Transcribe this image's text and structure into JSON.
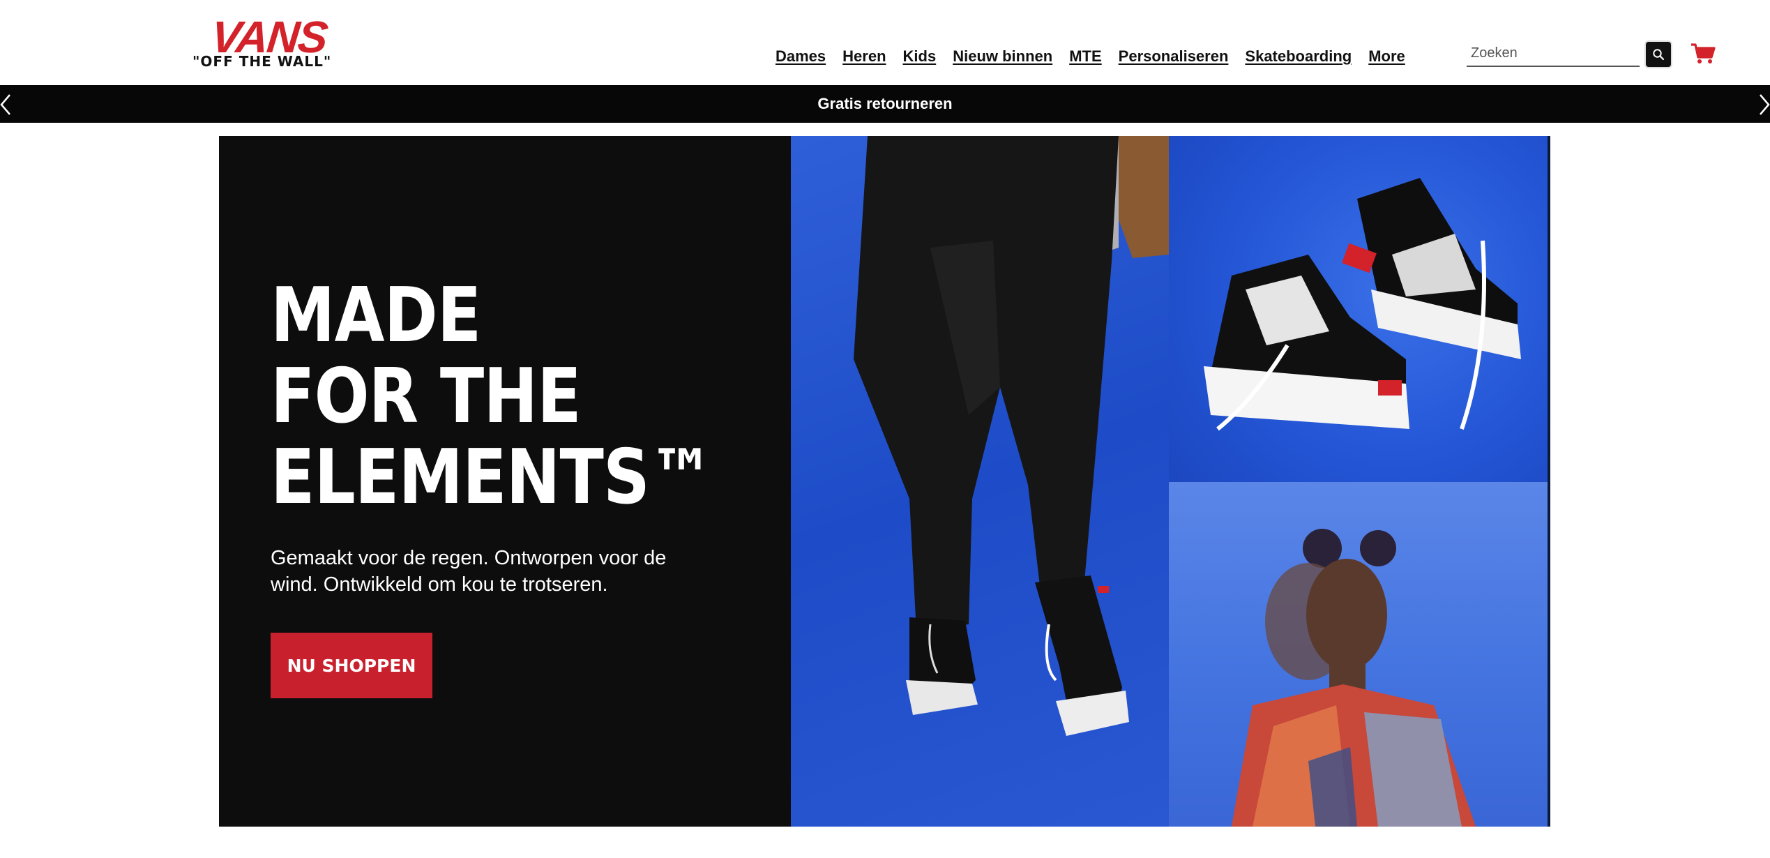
{
  "brand": {
    "logo_text": "VANS",
    "tagline": "\"OFF THE WALL\"",
    "accent": "#d3222a"
  },
  "nav": {
    "items": [
      {
        "label": "Dames"
      },
      {
        "label": "Heren"
      },
      {
        "label": "Kids"
      },
      {
        "label": "Nieuw binnen"
      },
      {
        "label": "MTE"
      },
      {
        "label": "Personaliseren"
      },
      {
        "label": "Skateboarding"
      },
      {
        "label": "More"
      }
    ]
  },
  "search": {
    "placeholder": "Zoeken",
    "icon": "search-icon"
  },
  "cart": {
    "icon": "cart-icon"
  },
  "announcement": {
    "text": "Gratis retourneren",
    "prev_icon": "chevron-left-icon",
    "next_icon": "chevron-right-icon"
  },
  "hero": {
    "title": "MADE\nFOR THE\nELEMENTS™",
    "subtitle": "Gemaakt voor de regen. Ontworpen voor de wind. Ontwikkeld om kou te trotseren.",
    "cta_label": "NU SHOPPEN",
    "cta_color": "#c9202d",
    "panel_color": "#0d0d0d",
    "image_bg_color": "#2456d6"
  }
}
